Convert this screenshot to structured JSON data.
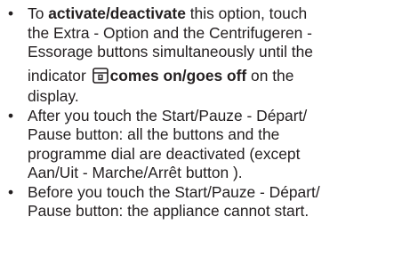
{
  "bullet_glyph": "•",
  "colors": {
    "text": "#231f20",
    "background": "#ffffff"
  },
  "icons": {
    "lock": "child-lock-icon"
  },
  "bullets": [
    {
      "line1_pre": "To ",
      "line1_bold": "activate/deactivate",
      "line1_post": " this option, touch",
      "line2": "the Extra - Option and the Centrifugeren -",
      "line3": "Essorage buttons simultaneously until the",
      "line4_pre": "indicator ",
      "line4_bold": "comes on/goes off",
      "line4_post": " on the",
      "line5": "display."
    },
    {
      "line1": "After you touch the Start/Pauze - Départ/",
      "line2": "Pause button: all the buttons and the",
      "line3": "programme dial are deactivated (except",
      "line4": "Aan/Uit - Marche/Arrêt button )."
    },
    {
      "line1": "Before you touch the Start/Pauze - Départ/",
      "line2": "Pause button: the appliance cannot start."
    }
  ]
}
